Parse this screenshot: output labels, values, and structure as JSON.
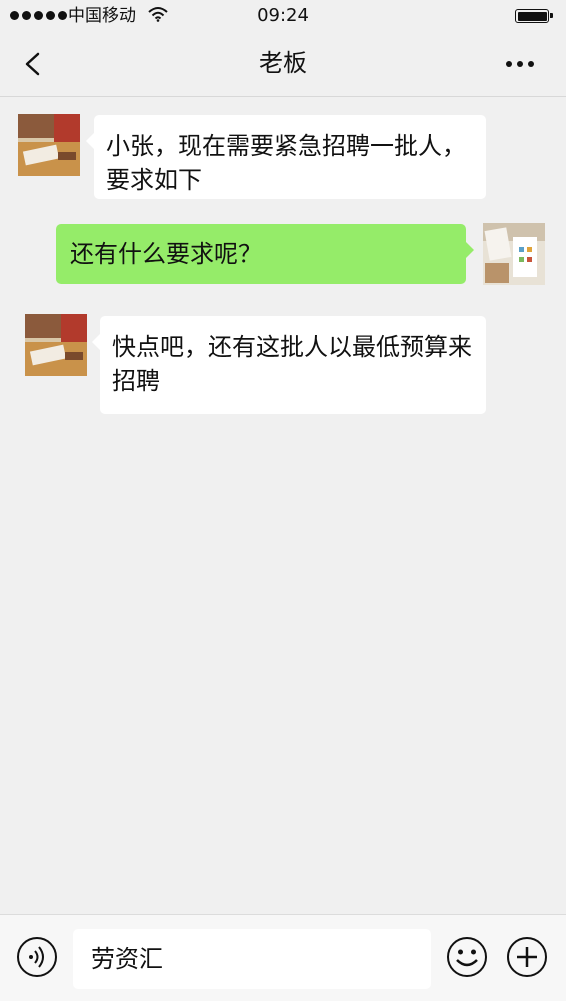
{
  "status_bar": {
    "carrier": "中国移动",
    "time": "09:24"
  },
  "nav": {
    "title": "老板"
  },
  "messages": [
    {
      "from": "boss",
      "text": "小张，现在需要紧急招聘一批人，要求如下"
    },
    {
      "from": "me",
      "text": "还有什么要求呢？"
    },
    {
      "from": "boss",
      "text": "快点吧，还有这批人以最低预算来招聘"
    }
  ],
  "input": {
    "value": "劳资汇"
  },
  "colors": {
    "background": "#f0f0f0",
    "bubble_incoming": "#ffffff",
    "bubble_outgoing": "#95ec69"
  },
  "icons": {
    "back": "chevron-left-icon",
    "more": "more-dots-icon",
    "voice": "voice-icon",
    "emoji": "emoji-icon",
    "add": "plus-icon"
  }
}
